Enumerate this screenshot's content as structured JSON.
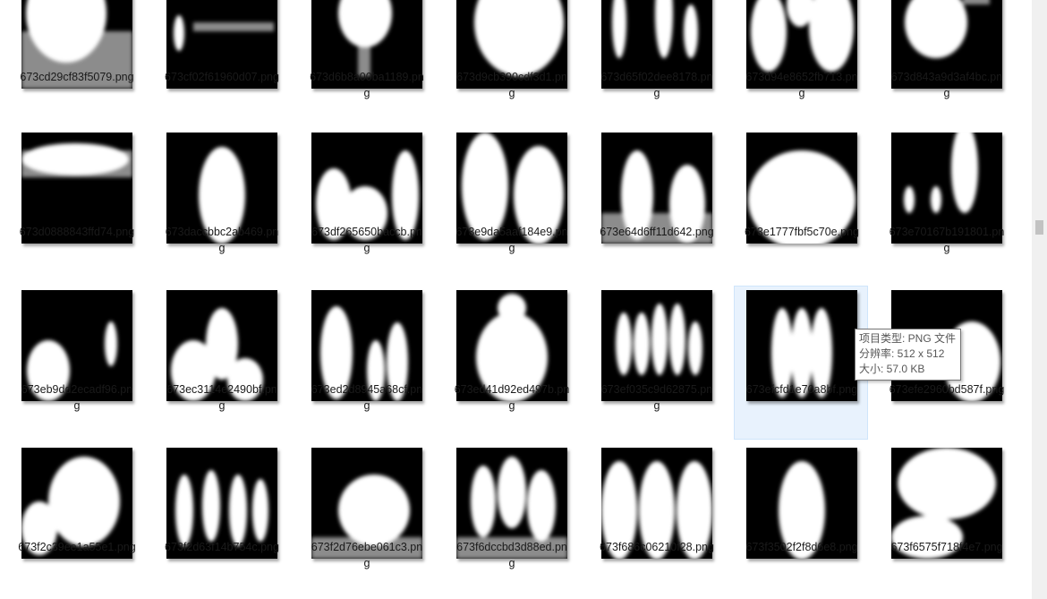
{
  "files": [
    {
      "name": "673cd29cf83f5079.png",
      "line1": "673cd29cf83f5079.png",
      "line2": "",
      "icon": "mask-thumbnail"
    },
    {
      "name": "673cf02f61960d07.png",
      "line1": "673cf02f61960d07.png",
      "line2": "",
      "icon": "mask-thumbnail"
    },
    {
      "name": "673d6b8a00ba1189.png",
      "line1": "673d6b8a00ba1189.pn",
      "line2": "g",
      "icon": "mask-thumbnail"
    },
    {
      "name": "673d9cb390cdf3d1.png",
      "line1": "673d9cb390cdf3d1.pn",
      "line2": "g",
      "icon": "mask-thumbnail"
    },
    {
      "name": "673d65f02dee8178.png",
      "line1": "673d65f02dee8178.pn",
      "line2": "g",
      "icon": "mask-thumbnail"
    },
    {
      "name": "673d94e8652fb713.png",
      "line1": "673d94e8652fb713.pn",
      "line2": "g",
      "icon": "mask-thumbnail"
    },
    {
      "name": "673d843a9d3af4bc.png",
      "line1": "673d843a9d3af4bc.pn",
      "line2": "g",
      "icon": "mask-thumbnail"
    },
    {
      "name": "673d0888843ffd74.png",
      "line1": "673d0888843ffd74.png",
      "line2": "",
      "icon": "mask-thumbnail"
    },
    {
      "name": "673daccbbc2ab469.png",
      "line1": "673daccbbc2ab469.pn",
      "line2": "g",
      "icon": "mask-thumbnail"
    },
    {
      "name": "673df265650baccb.png",
      "line1": "673df265650baccb.pn",
      "line2": "g",
      "icon": "mask-thumbnail"
    },
    {
      "name": "673e9da5aaf184e9.png",
      "line1": "673e9da5aaf184e9.pn",
      "line2": "g",
      "icon": "mask-thumbnail"
    },
    {
      "name": "673e64d6ff11d642.png",
      "line1": "673e64d6ff11d642.png",
      "line2": "",
      "icon": "mask-thumbnail"
    },
    {
      "name": "673e1777fbf5c70e.png",
      "line1": "673e1777fbf5c70e.png",
      "line2": "",
      "icon": "mask-thumbnail"
    },
    {
      "name": "673e70167b191801.png",
      "line1": "673e70167b191801.pn",
      "line2": "g",
      "icon": "mask-thumbnail"
    },
    {
      "name": "673eb9dd2ecadf96.png",
      "line1": "673eb9dd2ecadf96.pn",
      "line2": "g",
      "icon": "mask-thumbnail"
    },
    {
      "name": "673ec3114e2490bf.png",
      "line1": "673ec3114e2490bf.pn",
      "line2": "g",
      "icon": "mask-thumbnail"
    },
    {
      "name": "673ed2d8945a68cf.png",
      "line1": "673ed2d8945a68cf.pn",
      "line2": "g",
      "icon": "mask-thumbnail"
    },
    {
      "name": "673ed41d92ed497b.png",
      "line1": "673ed41d92ed497b.pn",
      "line2": "g",
      "icon": "mask-thumbnail"
    },
    {
      "name": "673ef035c9d62875.png",
      "line1": "673ef035c9d62875.pn",
      "line2": "g",
      "icon": "mask-thumbnail"
    },
    {
      "name": "673efcfd1e70a8bf.png",
      "line1": "673efcfd1e70a8bf.png",
      "line2": "",
      "icon": "mask-thumbnail",
      "selected": true
    },
    {
      "name": "673efe2960bd587f.png",
      "line1": "673efe2960bd587f.png",
      "line2": "",
      "icon": "mask-thumbnail"
    },
    {
      "name": "673f2c39ee1a55e1.png",
      "line1": "673f2c39ee1a55e1.png",
      "line2": "",
      "icon": "mask-thumbnail"
    },
    {
      "name": "673f2d63f14b754c.png",
      "line1": "673f2d63f14b754c.png",
      "line2": "",
      "icon": "mask-thumbnail"
    },
    {
      "name": "673f2d76ebe061c3.png",
      "line1": "673f2d76ebe061c3.pn",
      "line2": "g",
      "icon": "mask-thumbnail"
    },
    {
      "name": "673f6dccbd3d88ed.png",
      "line1": "673f6dccbd3d88ed.pn",
      "line2": "g",
      "icon": "mask-thumbnail"
    },
    {
      "name": "673f686c06210f28.png",
      "line1": "673f686c06210f28.png",
      "line2": "",
      "icon": "mask-thumbnail"
    },
    {
      "name": "673f3502f2f8d6e8.png",
      "line1": "673f3502f2f8d6e8.png",
      "line2": "",
      "icon": "mask-thumbnail"
    },
    {
      "name": "673f6575f718f4e7.png",
      "line1": "673f6575f718f4e7.png",
      "line2": "",
      "icon": "mask-thumbnail"
    }
  ],
  "tooltip": {
    "type": "项目类型: PNG 文件",
    "resolution": "分辨率: 512 x 512",
    "size": "大小: 57.0 KB"
  },
  "colors": {
    "selection_bg": "#e8f2fd",
    "selection_border": "#cfe5fb",
    "thumb_bg": "#000000",
    "mask_fg": "#ffffff"
  }
}
